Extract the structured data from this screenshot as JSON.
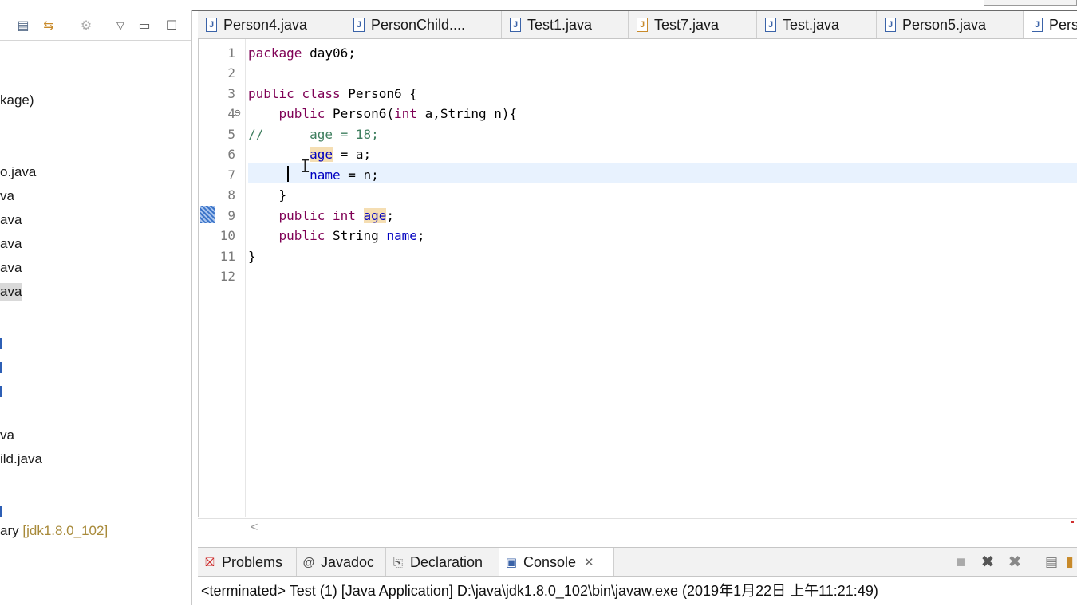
{
  "left_panel": {
    "tree_items": [
      {
        "text": "kage)"
      },
      {
        "text": "o.java"
      },
      {
        "text": "va"
      },
      {
        "text": "ava"
      },
      {
        "text": "ava"
      },
      {
        "text": "ava"
      },
      {
        "text": "ava",
        "selected": true
      },
      {
        "text": "va"
      },
      {
        "text": "ild.java"
      },
      {
        "text": "ary",
        "suffix": "[jdk1.8.0_102]"
      }
    ]
  },
  "editor_tabs": [
    {
      "label": "Person4.java"
    },
    {
      "label": "PersonChild...."
    },
    {
      "label": "Test1.java"
    },
    {
      "label": "Test7.java"
    },
    {
      "label": "Test.java"
    },
    {
      "label": "Person5.java"
    },
    {
      "label": "Pers",
      "active": true
    }
  ],
  "editor": {
    "line_numbers": [
      "1",
      "2",
      "3",
      "4",
      "5",
      "6",
      "7",
      "8",
      "9",
      "10",
      "11",
      "12"
    ],
    "code": {
      "l1_kw": "package",
      "l1_rest": " day06;",
      "l3_kw1": "public",
      "l3_kw2": "class",
      "l3_rest": " Person6 {",
      "l4_kw": "public",
      "l4_rest": " Person6(",
      "l4_kw2": "int",
      "l4_rest2": " a,String n){",
      "l5_comment": "//      age = 18;",
      "l6_field": "age",
      "l6_rest": " = a;",
      "l7_field": "name",
      "l7_rest": " = n;",
      "l8": "}",
      "l9_kw1": "public",
      "l9_kw2": "int",
      "l9_field": "age",
      "l9_rest": ";",
      "l10_kw": "public",
      "l10_type": " String ",
      "l10_field": "name",
      "l10_rest": ";",
      "l11": "}"
    }
  },
  "bottom_panel": {
    "tabs": [
      {
        "label": "Problems"
      },
      {
        "label": "Javadoc"
      },
      {
        "label": "Declaration"
      },
      {
        "label": "Console",
        "active": true
      }
    ],
    "console_text": "<terminated> Test (1) [Java Application] D:\\java\\jdk1.8.0_102\\bin\\javaw.exe (2019年1月22日 上午11:21:49)"
  },
  "colors": {
    "keyword": "#7f0055",
    "field": "#0000c0",
    "comment": "#3f7f5f",
    "occurrence_highlight": "#f5deb3",
    "current_line": "#e8f2fe"
  }
}
